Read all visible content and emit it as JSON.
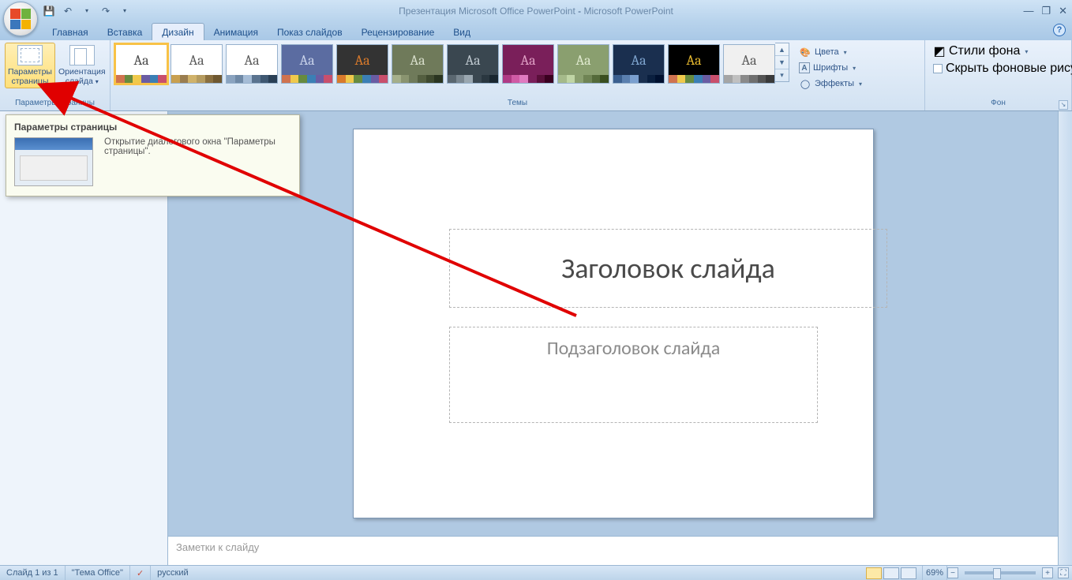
{
  "title": {
    "doc": "Презентация Microsoft Office PowerPoint",
    "sep": " - ",
    "app": "Microsoft PowerPoint"
  },
  "qat": {
    "save_icon": "💾",
    "undo_icon": "↶",
    "redo_icon": "↷",
    "dd": "▾"
  },
  "win": {
    "min": "—",
    "restore": "❐",
    "close": "✕"
  },
  "tabs": [
    {
      "id": "home",
      "label": "Главная"
    },
    {
      "id": "insert",
      "label": "Вставка"
    },
    {
      "id": "design",
      "label": "Дизайн",
      "active": true
    },
    {
      "id": "anim",
      "label": "Анимация"
    },
    {
      "id": "show",
      "label": "Показ слайдов"
    },
    {
      "id": "review",
      "label": "Рецензирование"
    },
    {
      "id": "view",
      "label": "Вид"
    }
  ],
  "help_icon": "?",
  "ribbon": {
    "pagesetup_group_label": "Параметры страницы",
    "page_setup_btn": "Параметры\nстраницы",
    "orientation_btn": "Ориентация\nслайда",
    "orientation_dd": "▾",
    "themes_group_label": "Темы",
    "themes": [
      {
        "bg": "#ffffff",
        "fg": "#4a4a4a",
        "stripe": [
          "#d0734f",
          "#678b3f",
          "#efc94c",
          "#6a5ca3",
          "#3b7fb5",
          "#c94f6c"
        ],
        "sel": true
      },
      {
        "bg": "#ffffff",
        "fg": "#5a5a5a",
        "stripe": [
          "#c9a04f",
          "#9a7d4f",
          "#d0b26a",
          "#b59b5f",
          "#8a6f3f",
          "#6f5830"
        ]
      },
      {
        "bg": "#ffffff",
        "fg": "#5a5a5a",
        "stripe": [
          "#8aa3bf",
          "#6f89a6",
          "#a5bcd6",
          "#5a738f",
          "#3f5872",
          "#2a3f55"
        ]
      },
      {
        "bg": "#5b6ca1",
        "fg": "#c9d3ea",
        "stripe": [
          "#d0734f",
          "#efc94c",
          "#678b3f",
          "#3b7fb5",
          "#6a5ca3",
          "#c94f6c"
        ]
      },
      {
        "bg": "#333333",
        "fg": "#d97a2b",
        "stripe": [
          "#d97a2b",
          "#efc94c",
          "#678b3f",
          "#3b7fb5",
          "#6a5ca3",
          "#c94f6c"
        ]
      },
      {
        "bg": "#6f7a5a",
        "fg": "#d8decb",
        "stripe": [
          "#a5af8a",
          "#8a9470",
          "#6f7a5a",
          "#545f40",
          "#3f4a2f",
          "#2a3520"
        ]
      },
      {
        "bg": "#3a4750",
        "fg": "#bfc9d0",
        "stripe": [
          "#5a6770",
          "#7a8790",
          "#9aa7b0",
          "#3a4750",
          "#2a3740",
          "#1a2730"
        ]
      },
      {
        "bg": "#7a1f5a",
        "fg": "#e0a0c5",
        "stripe": [
          "#b03a85",
          "#d05aa5",
          "#e07ac0",
          "#7a1f5a",
          "#5a0f3a",
          "#3a0020"
        ]
      },
      {
        "bg": "#8a9f6f",
        "fg": "#e0eacf",
        "stripe": [
          "#a5ba8a",
          "#c0d5a5",
          "#8a9f6f",
          "#6f8454",
          "#546a3a",
          "#3a4f20"
        ]
      },
      {
        "bg": "#1a2f4f",
        "fg": "#7fa5d0",
        "stripe": [
          "#3a5f8f",
          "#5a7faf",
          "#7a9fcf",
          "#1a2f4f",
          "#0a1f3f",
          "#00102f"
        ]
      },
      {
        "bg": "#000000",
        "fg": "#e5b82f",
        "stripe": [
          "#d0734f",
          "#efc94c",
          "#678b3f",
          "#3b7fb5",
          "#6a5ca3",
          "#c94f6c"
        ]
      },
      {
        "bg": "#f0f0f0",
        "fg": "#5a5a5a",
        "stripe": [
          "#a5a5a5",
          "#c0c0c0",
          "#8a8a8a",
          "#6f6f6f",
          "#545454",
          "#3a3a3a"
        ]
      }
    ],
    "themes_more": [
      "▲",
      "▼",
      "▾"
    ],
    "colors_label": "Цвета",
    "fonts_label": "Шрифты",
    "effects_label": "Эффекты",
    "bg_group_label": "Фон",
    "bg_styles_label": "Стили фона",
    "hide_bg_label": "Скрыть фоновые рисунки"
  },
  "tooltip": {
    "title": "Параметры страницы",
    "desc": "Открытие диалогового окна \"Параметры страницы\"."
  },
  "slide": {
    "title_ph": "Заголовок слайда",
    "sub_ph": "Подзаголовок слайда"
  },
  "notes_ph": "Заметки к слайду",
  "status": {
    "slide_info": "Слайд 1 из 1",
    "theme_name": "\"Тема Office\"",
    "lang_icon": "✓",
    "lang": "русский",
    "zoom_pct": "69%",
    "fit_icon": "⛶"
  }
}
